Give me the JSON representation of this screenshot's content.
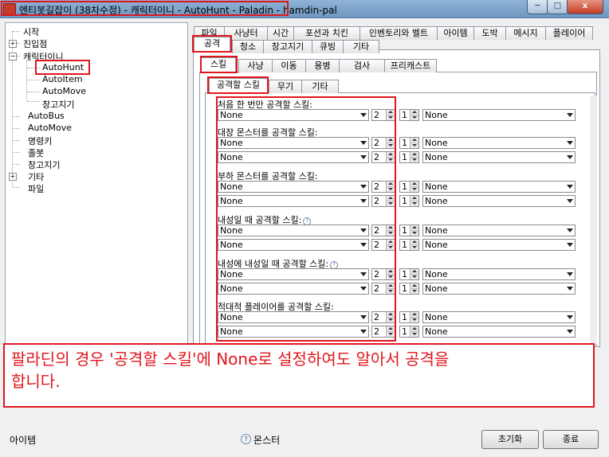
{
  "window": {
    "title": "엔티봇길잡이 (38차수정) - 캐릭터이니 - AutoHunt - Paladin - hamdin-pal",
    "minimize": "─",
    "maximize": "□",
    "close": "x"
  },
  "tree": {
    "items": [
      "시작",
      "진입점",
      "캐릭터이니",
      "AutoHunt",
      "AutoItem",
      "AutoMove",
      "창고지기",
      "AutoBus",
      "AutoMove",
      "명령키",
      "졸봇",
      "창고지기",
      "기타",
      "파일"
    ]
  },
  "tabs": {
    "top_row": [
      "파일",
      "사냥터",
      "시간",
      "포션과 치킨",
      "인벤토리와 벨트",
      "아이템",
      "도박",
      "메시지",
      "플레이어"
    ],
    "second_row": [
      "공격",
      "청소",
      "창고지기",
      "큐빙",
      "기타"
    ],
    "third_row": [
      "스킬",
      "사냥",
      "이동",
      "용병",
      "검사",
      "프리캐스트"
    ],
    "fourth_row": [
      "공격할 스킬",
      "무기",
      "기타"
    ]
  },
  "groups": [
    {
      "label": "처음 한 번만 공격할 스킬:",
      "help": false,
      "rows": [
        {
          "skill": "None",
          "count": "2",
          "num": "1",
          "skill2": "None"
        }
      ]
    },
    {
      "label": "대장 몬스터를 공격할 스킬:",
      "help": false,
      "rows": [
        {
          "skill": "None",
          "count": "2",
          "num": "1",
          "skill2": "None"
        },
        {
          "skill": "None",
          "count": "2",
          "num": "1",
          "skill2": "None"
        }
      ]
    },
    {
      "label": "부하 몬스터를 공격할 스킬:",
      "help": false,
      "rows": [
        {
          "skill": "None",
          "count": "2",
          "num": "1",
          "skill2": "None"
        },
        {
          "skill": "None",
          "count": "2",
          "num": "1",
          "skill2": "None"
        }
      ]
    },
    {
      "label": "내성일 때 공격할 스킬:",
      "help": true,
      "rows": [
        {
          "skill": "None",
          "count": "2",
          "num": "1",
          "skill2": "None"
        },
        {
          "skill": "None",
          "count": "2",
          "num": "1",
          "skill2": "None"
        }
      ]
    },
    {
      "label": "내성에 내성일 때 공격할 스킬:",
      "help": true,
      "rows": [
        {
          "skill": "None",
          "count": "2",
          "num": "1",
          "skill2": "None"
        },
        {
          "skill": "None",
          "count": "2",
          "num": "1",
          "skill2": "None"
        }
      ]
    },
    {
      "label": "적대적 플레이어를 공격할 스킬:",
      "help": false,
      "rows": [
        {
          "skill": "None",
          "count": "2",
          "num": "1",
          "skill2": "None"
        },
        {
          "skill": "None",
          "count": "2",
          "num": "1",
          "skill2": "None"
        }
      ]
    }
  ],
  "help_glyph": "?",
  "overlay": {
    "line1": "팔라딘의 경우 '공격할 스킬'에 None로 설정하여도 알아서 공격을",
    "line2": "합니다."
  },
  "status": {
    "left": "아이템",
    "mid": "몬스터",
    "reset": "초기화",
    "exit": "종료"
  },
  "colors": {
    "highlight": "#e0161c",
    "titlebar": "#7fa6cc"
  }
}
